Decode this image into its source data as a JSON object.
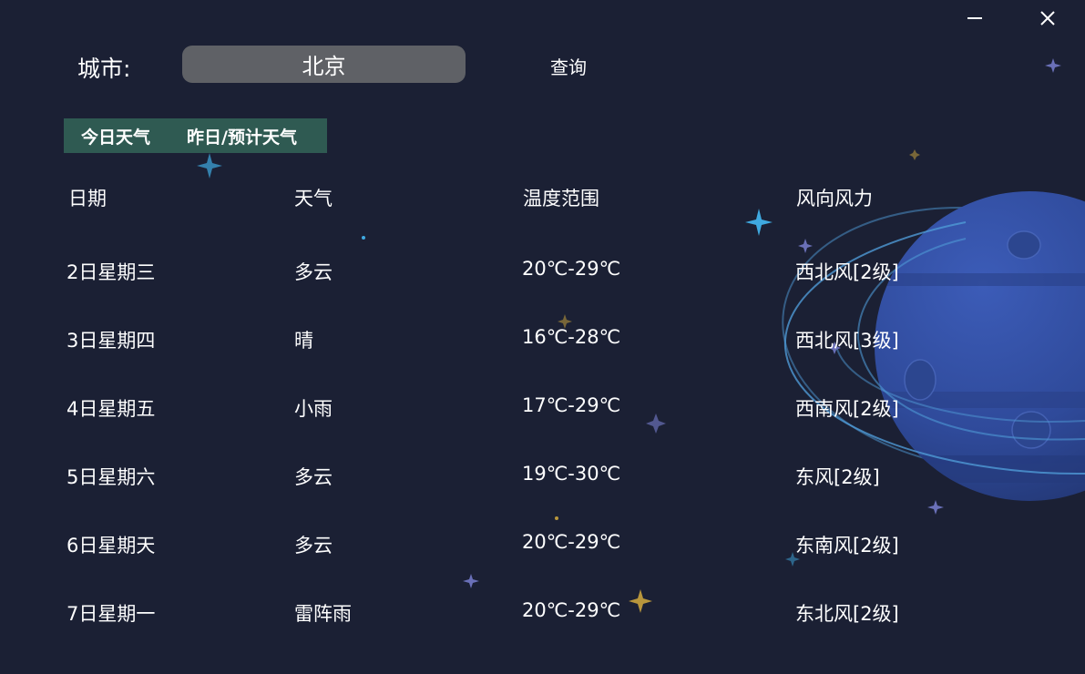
{
  "window": {
    "minimize_icon": "minimize-icon",
    "close_icon": "close-icon"
  },
  "search": {
    "label": "城市:",
    "value": "北京",
    "button_label": "查询"
  },
  "tabs": [
    {
      "label": "今日天气",
      "active": true
    },
    {
      "label": "昨日/预计天气",
      "active": false
    }
  ],
  "table": {
    "headers": [
      "日期",
      "天气",
      "温度范围",
      "风向风力"
    ],
    "rows": [
      {
        "date": "2日星期三",
        "weather": "多云",
        "temp": "20℃-29℃",
        "wind": "西北风[2级]"
      },
      {
        "date": "3日星期四",
        "weather": "晴",
        "temp": "16℃-28℃",
        "wind": "西北风[3级]"
      },
      {
        "date": "4日星期五",
        "weather": "小雨",
        "temp": "17℃-29℃",
        "wind": "西南风[2级]"
      },
      {
        "date": "5日星期六",
        "weather": "多云",
        "temp": "19℃-30℃",
        "wind": "东风[2级]"
      },
      {
        "date": "6日星期天",
        "weather": "多云",
        "temp": "20℃-29℃",
        "wind": "东南风[2级]"
      },
      {
        "date": "7日星期一",
        "weather": "雷阵雨",
        "temp": "20℃-29℃",
        "wind": "东北风[2级]"
      }
    ]
  },
  "colors": {
    "background": "#1b2034",
    "input_background": "#5f6166",
    "tab_background": "#2f5a52",
    "planet": "#2f4a9a",
    "text": "#ffffff"
  }
}
